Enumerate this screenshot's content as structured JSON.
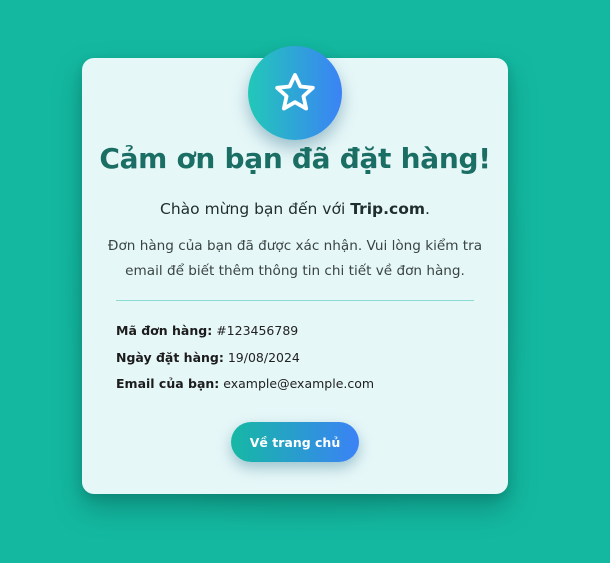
{
  "colors": {
    "background": "#14b8a0",
    "card": "#e6f7f8",
    "title": "#1a6e63",
    "accent_start": "#22c8b8",
    "accent_end": "#3b82f6",
    "divider": "#8adbd4"
  },
  "badge": {
    "icon": "star-icon"
  },
  "title": "Cảm ơn bạn đã đặt hàng!",
  "welcome": {
    "prefix": "Chào mừng bạn đến với ",
    "brand": "Trip.com",
    "suffix": "."
  },
  "description": "Đơn hàng của bạn đã được xác nhận. Vui lòng kiểm tra email để biết thêm thông tin chi tiết về đơn hàng.",
  "order": {
    "id_label": "Mã đơn hàng:",
    "id_value": "#123456789",
    "date_label": "Ngày đặt hàng:",
    "date_value": "19/08/2024",
    "email_label": "Email của bạn:",
    "email_value": "example@example.com"
  },
  "button": {
    "home_label": "Về trang chủ"
  }
}
